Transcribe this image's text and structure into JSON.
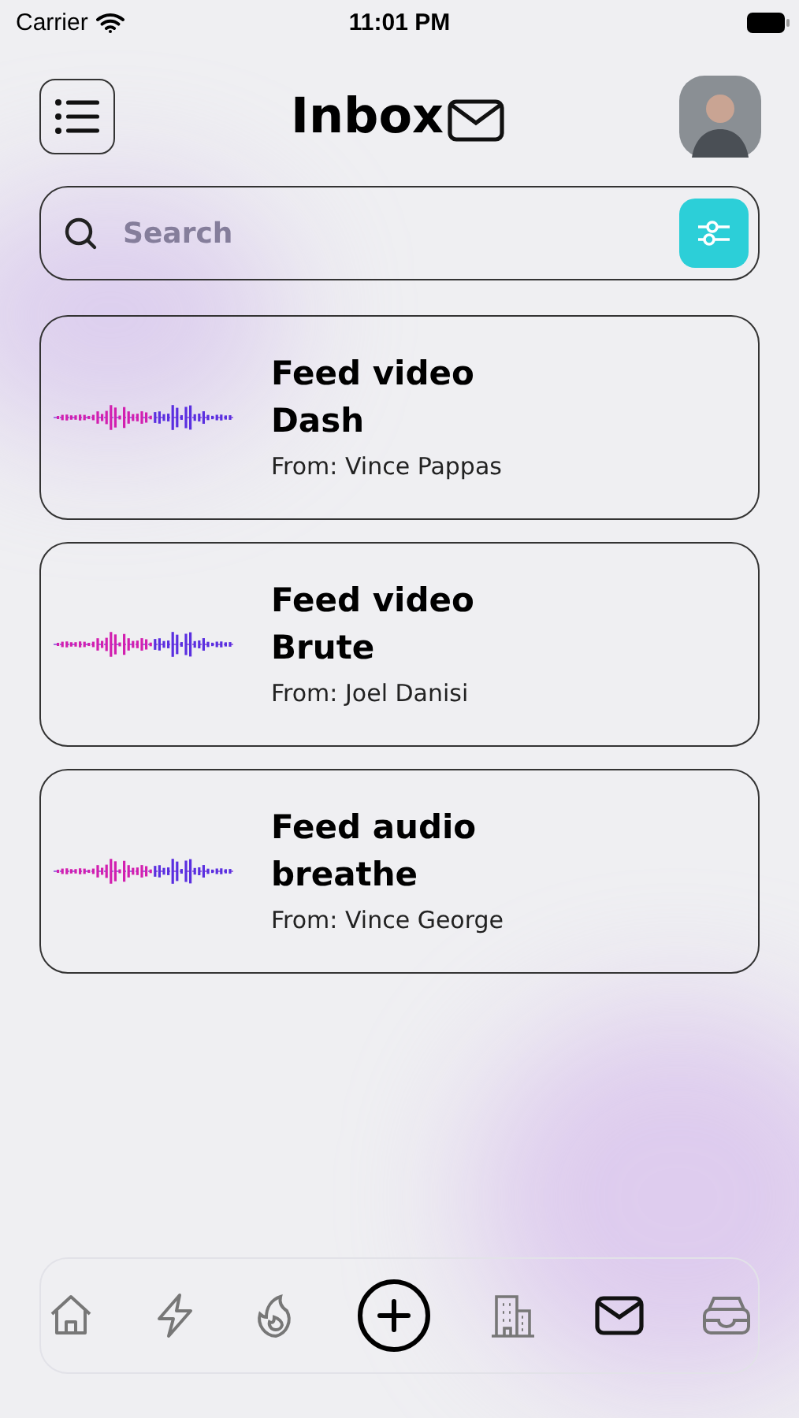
{
  "status_bar": {
    "carrier": "Carrier",
    "time": "11:01 PM"
  },
  "header": {
    "title": "Inbox"
  },
  "search": {
    "placeholder": "Search"
  },
  "messages": [
    {
      "type": "Feed video",
      "title": "Dash",
      "from": "From: Vince Pappas"
    },
    {
      "type": "Feed video",
      "title": "Brute",
      "from": "From: Joel Danisi"
    },
    {
      "type": "Feed audio",
      "title": "breathe",
      "from": "From: Vince George"
    }
  ],
  "nav": [
    {
      "kind": "home",
      "selected": false
    },
    {
      "kind": "bolt",
      "selected": false
    },
    {
      "kind": "flame",
      "selected": false
    },
    {
      "kind": "add",
      "selected": false
    },
    {
      "kind": "building",
      "selected": false
    },
    {
      "kind": "mail",
      "selected": true
    },
    {
      "kind": "tray",
      "selected": false
    }
  ]
}
